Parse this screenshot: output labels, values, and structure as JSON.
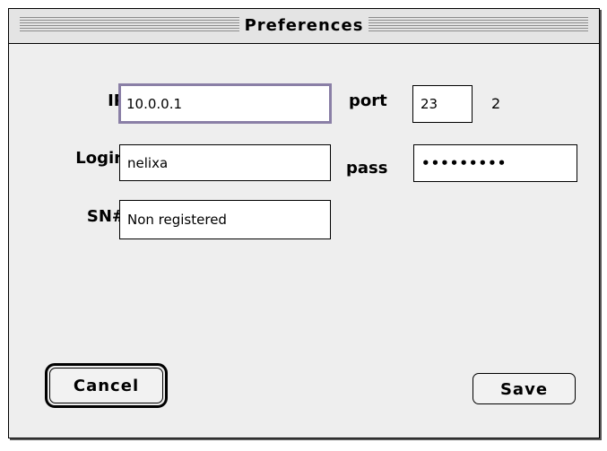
{
  "window": {
    "title": "Preferences"
  },
  "form": {
    "ip_label": "IP",
    "ip_value": "10.0.0.1",
    "port_label": "port",
    "port_value": "23",
    "port_extra": "2",
    "login_label": "Login",
    "login_value": "nelixa",
    "pass_label": "pass",
    "pass_value": "•••••••••",
    "sn_label": "SN#",
    "sn_value": "Non registered"
  },
  "buttons": {
    "cancel_label": "Cancel",
    "save_label": "Save"
  },
  "colors": {
    "focus_ring": "#8a7fa6",
    "window_bg": "#eeeeee"
  }
}
